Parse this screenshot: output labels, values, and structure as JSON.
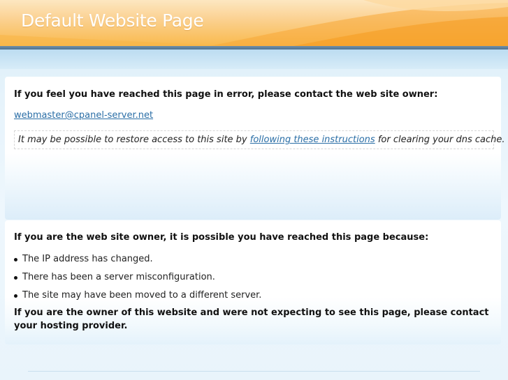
{
  "header": {
    "title": "Default Website Page",
    "colors": {
      "orange_light": "#fde7c1",
      "orange_dark": "#f9b94c",
      "bar": "#4f7391"
    }
  },
  "error_box": {
    "heading": "If you feel you have reached this page in error, please contact the web site owner:",
    "email": "webmaster@cpanel-server.net",
    "dns_text_before": "It may be possible to restore access to this site by ",
    "dns_link": "following these instructions",
    "dns_text_after": " for clearing your dns cache."
  },
  "owner_box": {
    "heading": "If you are the web site owner, it is possible you have reached this page because:",
    "reasons": [
      "The IP address has changed.",
      "There has been a server misconfiguration.",
      "The site may have been moved to a different server."
    ],
    "closing": "If you are the owner of this website and were not expecting to see this page, please contact your hosting provider."
  },
  "colors": {
    "link": "#2a6ea6",
    "background": "#e6f3fb"
  }
}
